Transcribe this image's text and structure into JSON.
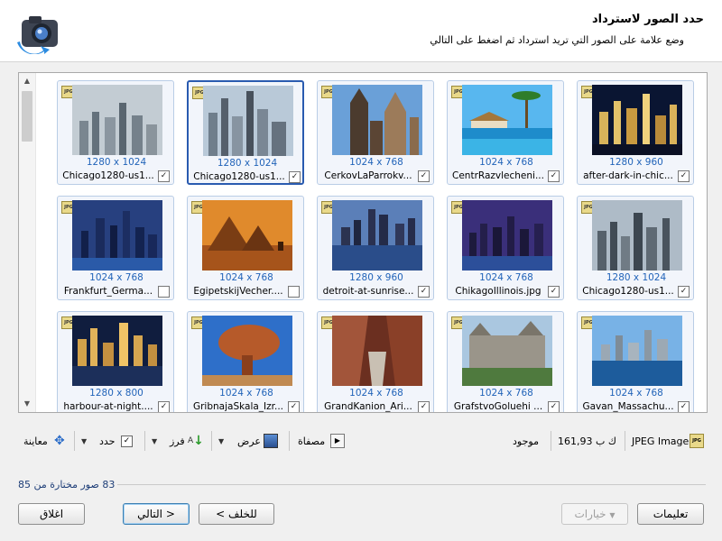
{
  "header": {
    "title": "حدد الصور لاسترداد",
    "subtitle": "وضع علامة على الصور التي تريد استرداد ثم اضغط على التالي"
  },
  "grid": {
    "items": [
      {
        "name": "after-dark-in-chic...",
        "dims": "1280 x 960",
        "checked": true
      },
      {
        "name": "CentrRazvlecheni...",
        "dims": "1024 x 768",
        "checked": true
      },
      {
        "name": "CerkovLaParrokv...",
        "dims": "1024 x 768",
        "checked": true
      },
      {
        "name": "Chicago1280-us1...",
        "dims": "1280 x 1024",
        "checked": true
      },
      {
        "name": "Chicago1280-us1...",
        "dims": "1280 x 1024",
        "checked": true
      },
      {
        "name": "Chicago1280-us1...",
        "dims": "1280 x 1024",
        "checked": true
      },
      {
        "name": "ChikagoIllinois.jpg",
        "dims": "1024 x 768",
        "checked": true
      },
      {
        "name": "detroit-at-sunrise...",
        "dims": "1280 x 960",
        "checked": true
      },
      {
        "name": "EgipetskijVecher....",
        "dims": "1024 x 768",
        "checked": false
      },
      {
        "name": "Frankfurt_Germa...",
        "dims": "1024 x 768",
        "checked": false
      },
      {
        "name": "Gavan_Massachu...",
        "dims": "1024 x 768",
        "checked": true
      },
      {
        "name": "GrafstvoGoluehi ...",
        "dims": "1024 x 768",
        "checked": true
      },
      {
        "name": "GrandKanion_Ari...",
        "dims": "1024 x 768",
        "checked": true
      },
      {
        "name": "GribnajaSkala_Izr...",
        "dims": "1024 x 768",
        "checked": true
      },
      {
        "name": "harbour-at-night....",
        "dims": "1280 x 800",
        "checked": true
      }
    ]
  },
  "toolbar": {
    "file_type": "JPEG Image",
    "file_size": "161,93 ك ب",
    "status": "موجود",
    "filter_label": "مصفاة",
    "view_label": "عرض",
    "sort_label": "فرز",
    "select_label": "حدد",
    "preview_label": "معاينة"
  },
  "footer": {
    "count_text": "83 صور مختارة من 85"
  },
  "buttons": {
    "help": "تعليمات",
    "options": "خيارات",
    "back": "< للخلف",
    "next": "التالي >",
    "close": "اغلاق"
  },
  "colors": {
    "accent": "#2264b9",
    "selected_border": "#2a5bb0"
  }
}
